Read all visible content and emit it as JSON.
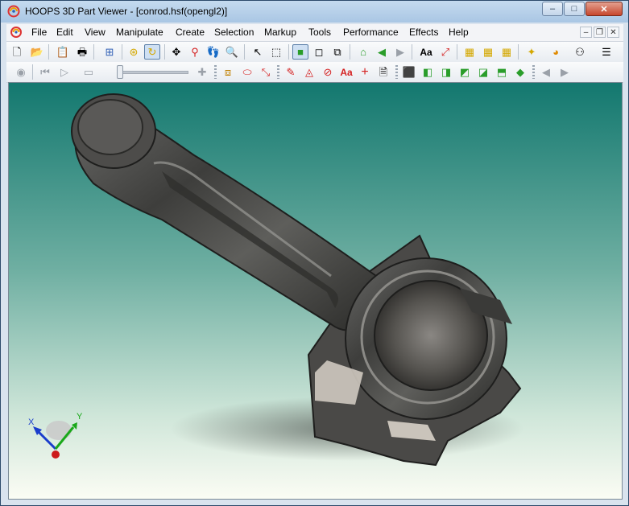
{
  "window": {
    "title": "HOOPS 3D Part Viewer - [conrod.hsf(opengl2)]",
    "controls": {
      "minimize": "–",
      "maximize": "□",
      "close": "✕"
    }
  },
  "menu": {
    "items": [
      "File",
      "Edit",
      "View",
      "Manipulate",
      "Create",
      "Selection",
      "Markup",
      "Tools",
      "Performance",
      "Effects",
      "Help"
    ],
    "mdi_controls": {
      "minimize": "–",
      "restore": "❐",
      "close": "✕"
    }
  },
  "toolbar1": {
    "icons": [
      "new-icon",
      "open-icon",
      "copy-icon",
      "print-icon",
      "fit-window-icon",
      "orbit-icon",
      "turntable-icon",
      "pan-icon",
      "zoom-icon",
      "walk-icon",
      "zoom-window-icon",
      "select-arrow-icon",
      "select-window-icon",
      "shaded-cube-icon",
      "wireframe-cube-icon",
      "hidden-line-cube-icon",
      "home-view-icon",
      "back-arrow-icon",
      "forward-arrow-icon",
      "text-annotation-icon",
      "measure-icon",
      "grid-xy-icon",
      "grid-xz-icon",
      "grid-yz-icon",
      "center-point-icon",
      "camera-icon",
      "network-icon",
      "list-icon"
    ],
    "text_button_label": "Aa"
  },
  "toolbar2": {
    "icons": [
      "record-icon",
      "step-back-icon",
      "play-icon",
      "stop-icon",
      "slider",
      "add-keyframe-icon",
      "markup-box-icon",
      "markup-cylinder-icon",
      "markup-line-icon",
      "freehand-icon",
      "markup-rect-icon",
      "markup-circle-icon",
      "markup-text-icon",
      "markup-cross-icon",
      "markup-note-icon",
      "iso-view-icon",
      "front-view-icon",
      "back-view-icon",
      "left-view-icon",
      "right-view-icon",
      "top-view-icon",
      "bottom-view-icon",
      "prev-view-icon",
      "next-view-icon"
    ],
    "text_button_label": "Aa",
    "animation_position": 0
  },
  "axis_triad": {
    "x_label": "X",
    "y_label": "Y"
  },
  "colors": {
    "viewport_top": "#13786f",
    "viewport_bottom": "#fbfcf4",
    "part_color": "#4a4a48",
    "axis_x": "#1a3dcc",
    "axis_y": "#1aa81a",
    "axis_z": "#cc1a1a"
  }
}
